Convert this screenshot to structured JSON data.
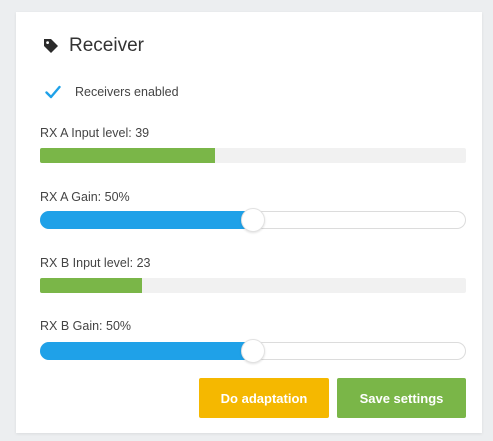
{
  "panel": {
    "title": "Receiver",
    "title_icon": "tag-icon"
  },
  "receivers_enabled": {
    "label": "Receivers enabled",
    "checked": true,
    "check_color": "#1fa1e8"
  },
  "rx_a_input": {
    "label": "RX A Input level: 39",
    "level_percent": 41
  },
  "rx_a_gain": {
    "label": "RX A Gain: 50%",
    "value_percent": 50
  },
  "rx_b_input": {
    "label": "RX B Input level: 23",
    "level_percent": 24
  },
  "rx_b_gain": {
    "label": "RX B Gain: 50%",
    "value_percent": 50
  },
  "buttons": {
    "adaptation": "Do adaptation",
    "save": "Save settings"
  },
  "colors": {
    "level_fill": "#7ab648",
    "slider_fill": "#1fa1e8",
    "adaptation_button": "#f5b800",
    "save_button": "#7ab648"
  }
}
